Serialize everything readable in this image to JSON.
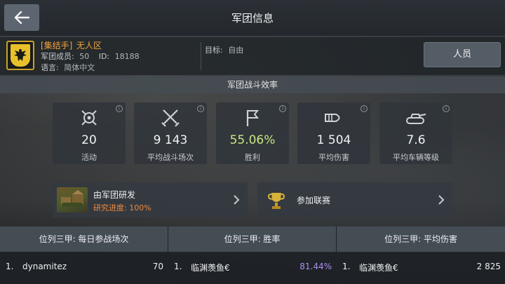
{
  "header": {
    "title": "军团信息",
    "back_icon": "arrow-left-icon"
  },
  "legion": {
    "tag": "[集结手]",
    "name": "无人区",
    "members_label": "军团成员:",
    "members_value": "50",
    "id_label": "ID:",
    "id_value": "18188",
    "language_label": "语言:",
    "language_value": "简体中文",
    "goal_label": "目标:",
    "goal_value": "自由",
    "members_button": "人员",
    "emblem_icon": "eagle-emblem-icon"
  },
  "efficiency": {
    "title": "军团战斗效率",
    "stats": [
      {
        "value": "20",
        "label": "活动",
        "icon": "activity-medal-icon"
      },
      {
        "value": "9 143",
        "label": "平均战斗场次",
        "icon": "crossed-swords-icon"
      },
      {
        "value": "55.06%",
        "label": "胜利",
        "icon": "flag-icon"
      },
      {
        "value": "1 504",
        "label": "平均伤害",
        "icon": "shell-icon"
      },
      {
        "value": "7.6",
        "label": "平均车辆等级",
        "icon": "tank-icon"
      }
    ]
  },
  "actions": {
    "research": {
      "title": "由军团研发",
      "progress": "研究进度: 100%"
    },
    "league": {
      "title": "参加联赛",
      "icon": "trophy-icon"
    }
  },
  "top3": {
    "columns": [
      {
        "header": "位列三甲: 每日参战场次",
        "rank": "1.",
        "player": "dynamitez",
        "value": "70"
      },
      {
        "header": "位列三甲: 胜率",
        "rank": "1.",
        "player": "临渊羡鱼€",
        "value": "81.44%"
      },
      {
        "header": "位列三甲: 平均伤害",
        "rank": "1.",
        "player": "临渊羡鱼€",
        "value": "2 825"
      }
    ]
  },
  "colors": {
    "accent_orange": "#f0a13a",
    "win_green": "#c6e87e",
    "winrate_purple": "#a98ef0"
  }
}
